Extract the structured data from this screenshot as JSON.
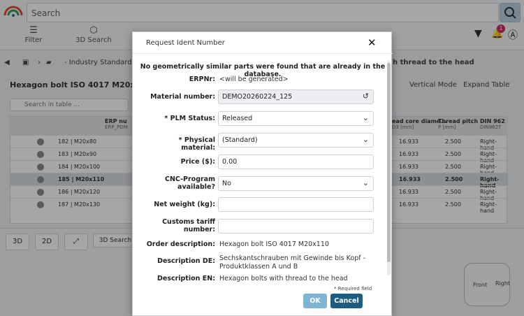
{
  "search": {
    "placeholder": "Search"
  },
  "nav": [
    "Filter",
    "3D Search"
  ],
  "breadcrumb": {
    "segment": "- Industry Standards -",
    "tail": "h thread to the head"
  },
  "part": {
    "title": "Hexagon bolt ISO 4017 M20x110"
  },
  "table_tools": {
    "vertical_mode": "Vertical Mode",
    "expand_table": "Expand Table"
  },
  "table_search": {
    "placeholder": "Search in table ..."
  },
  "grid": {
    "headers": [
      {
        "label": "ERP nu",
        "sub": "ERP_PDM"
      },
      {
        "label": "ead core diame...",
        "sub": "D3 [mm]"
      },
      {
        "label": "Thread pitch",
        "sub": "P [mm]"
      },
      {
        "label": "DIN 962",
        "sub": "DIN962T"
      }
    ],
    "rows": [
      {
        "name": "182 | M20x80",
        "d3": "16.933",
        "p": "2.500",
        "t": "Right-hand"
      },
      {
        "name": "183 | M20x90",
        "d3": "16.933",
        "p": "2.500",
        "t": "Right-hand"
      },
      {
        "name": "184 | M20x100",
        "d3": "16.933",
        "p": "2.500",
        "t": "Right-hand"
      },
      {
        "name": "185 | M20x110",
        "d3": "16.933",
        "p": "2.500",
        "t": "Right-hand"
      },
      {
        "name": "186 | M20x120",
        "d3": "16.933",
        "p": "2.500",
        "t": "Right-hand"
      },
      {
        "name": "187 | M20x130",
        "d3": "16.933",
        "p": "2.500",
        "t": "Right-hand"
      }
    ]
  },
  "bottom": {
    "tab_3d": "3D",
    "tab_2d": "2D",
    "search_3d": "3D Search",
    "cube_front": "Front",
    "cube_right": "Right"
  },
  "modal": {
    "title": "Request Ident Number",
    "notice": "No geometrically similar parts were found that are already in the database.",
    "erp_label": "ERPNr:",
    "erp_value": "<will be generated>",
    "material_label": "Material number:",
    "material_value": "DEMO20260224_125",
    "plm_label": "* PLM Status:",
    "plm_value": "Released",
    "phys_label": "* Physical material:",
    "phys_value": "(Standard)",
    "price_label": "Price ($):",
    "price_value": "0.00",
    "cnc_label": "CNC-Program available?",
    "cnc_value": "No",
    "weight_label": "Net weight (kg):",
    "weight_value": "",
    "customs_label": "Customs tariff number:",
    "customs_value": "",
    "order_label": "Order description:",
    "order_value": "Hexagon bolt ISO 4017 M20x110",
    "desc_de_label": "Description DE:",
    "desc_de_value": "Sechskantschrauben mit Gewinde bis Kopf - Produktklassen A und B",
    "desc_en_label": "Description EN:",
    "desc_en_value": "Hexagon bolts with thread to the head",
    "required_note": "* Required field",
    "ok": "OK",
    "cancel": "Cancel"
  }
}
